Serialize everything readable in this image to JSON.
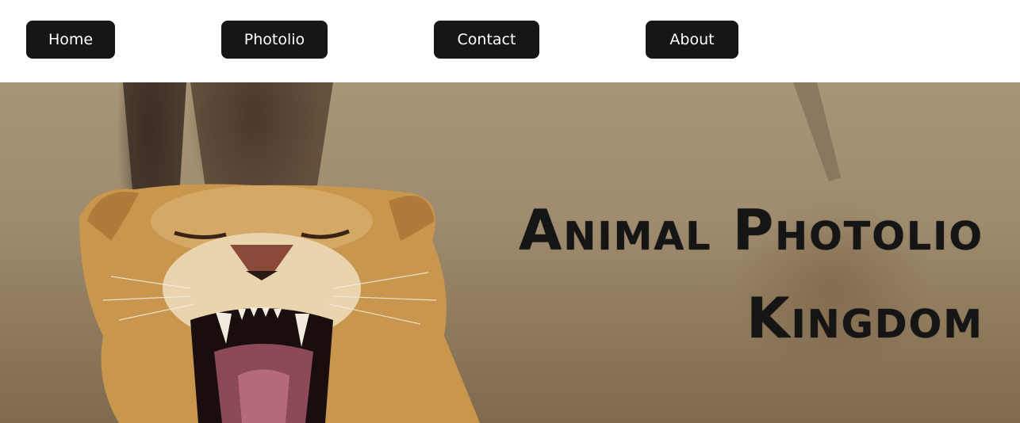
{
  "nav": {
    "items": [
      {
        "label": "Home"
      },
      {
        "label": "Photolio"
      },
      {
        "label": "Contact"
      },
      {
        "label": "About"
      }
    ]
  },
  "hero": {
    "title_line1": "Animal Photolio",
    "title_line2": "Kingdom",
    "image": "lioness yawning in dry grass"
  },
  "colors": {
    "nav_button_bg": "#161616",
    "nav_button_text": "#ffffff",
    "title_text": "#151515"
  }
}
